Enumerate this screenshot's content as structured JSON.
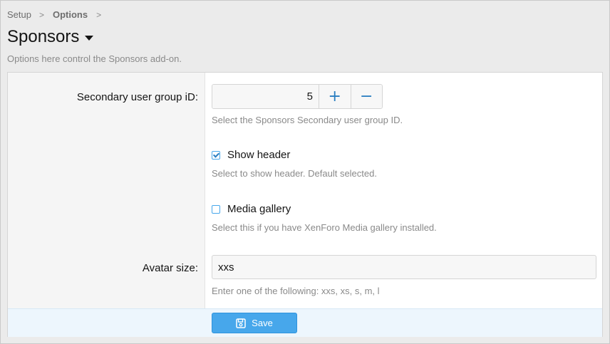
{
  "breadcrumb": {
    "items": [
      "Setup",
      "Options"
    ],
    "separator": ">"
  },
  "page": {
    "title": "Sponsors",
    "description": "Options here control the Sponsors add-on."
  },
  "options": {
    "secondary_group": {
      "label": "Secondary user group iD:",
      "value": "5",
      "increment_symbol": "+",
      "decrement_symbol": "−",
      "hint": "Select the Sponsors Secondary user group ID."
    },
    "show_header": {
      "label": "Show header",
      "checked": true,
      "hint": "Select to show header. Default selected."
    },
    "media_gallery": {
      "label": "Media gallery",
      "checked": false,
      "hint": "Select this if you have XenForo Media gallery installed."
    },
    "avatar_size": {
      "label": "Avatar size:",
      "value": "xxs",
      "hint": "Enter one of the following: xxs, xs, s, m, l"
    }
  },
  "footer": {
    "save_label": "Save",
    "save_icon": "save-icon"
  },
  "colors": {
    "accent": "#47a7eb",
    "link": "#2b7fc1",
    "footer_bg": "#edf6fd"
  }
}
